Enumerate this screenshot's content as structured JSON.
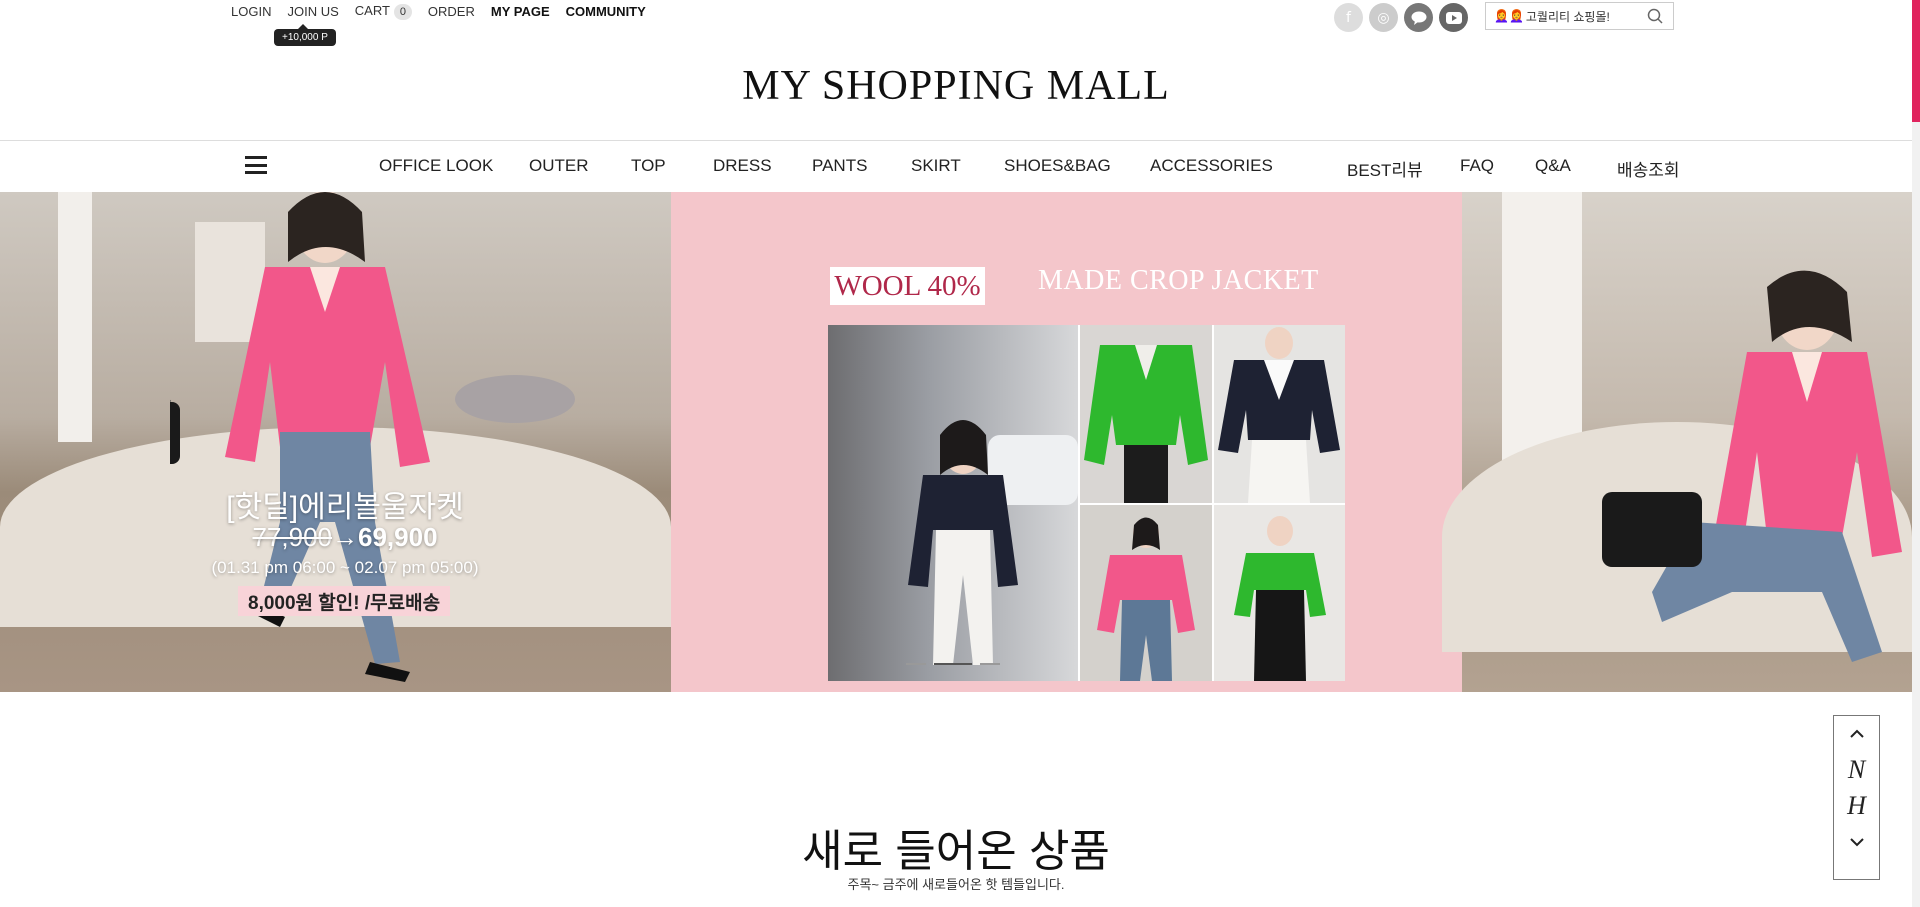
{
  "topbar": {
    "login": "LOGIN",
    "join": "JOIN US",
    "cart": "CART",
    "cart_count": "0",
    "order": "ORDER",
    "mypage": "MY PAGE",
    "community": "COMMUNITY",
    "point_tip": "+10,000 P"
  },
  "socials": [
    {
      "name": "facebook-icon",
      "glyph": "f"
    },
    {
      "name": "instagram-icon",
      "glyph": "◎"
    },
    {
      "name": "kakaotalk-icon",
      "glyph": "💬"
    },
    {
      "name": "youtube-icon",
      "glyph": "▶"
    }
  ],
  "search": {
    "emoji": "👩‍🦰👩‍🦰",
    "value": "고퀄리티 쇼핑몰!"
  },
  "logo": "MY SHOPPING MALL",
  "nav": {
    "categories": [
      "OFFICE LOOK",
      "OUTER",
      "TOP",
      "DRESS",
      "PANTS",
      "SKIRT",
      "SHOES&BAG",
      "ACCESSORIES"
    ],
    "extras": [
      "BEST리뷰",
      "FAQ",
      "Q&A",
      "배송조회"
    ]
  },
  "banner": {
    "promo_title": "[핫딜]에리볼울자켓",
    "old_price": "77,900",
    "new_price": "69,900",
    "date": "(01.31 pm 06:00 ~ 02.07 pm 05:00)",
    "badge": "8,000원 할인! /무료배송",
    "wool": "WOOL 40%",
    "headline": "MADE CROP JACKET"
  },
  "scroll_widget": {
    "letters": [
      "N",
      "H"
    ]
  },
  "section": {
    "title": "새로 들어온 상품",
    "subtitle": "주목~ 금주에 새로들어온 핫 템들입니다."
  },
  "colors": {
    "banner_pink": "#f4c6cb",
    "jacket_pink": "#f2578a",
    "jacket_green": "#2eb82e",
    "jacket_navy": "#1e2233",
    "scroll_accent": "#e0245e"
  }
}
